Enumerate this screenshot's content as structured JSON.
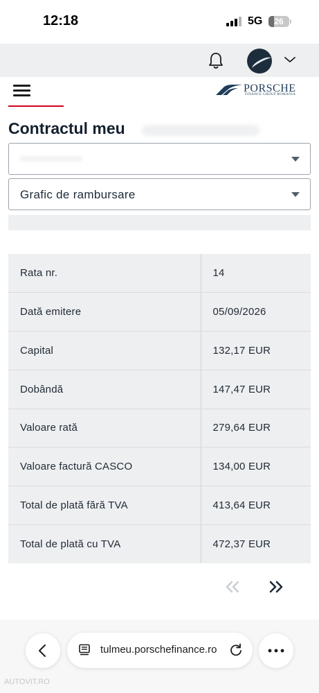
{
  "status_bar": {
    "time": "12:18",
    "network": "5G",
    "battery": "26",
    "battery_level": 0.26
  },
  "header": {
    "logo_text": "PORSCHE",
    "logo_subtext": "FINANCE GROUP ROMANIA"
  },
  "page": {
    "title": "Contractul meu",
    "contract_select_value": "",
    "view_select_value": "Grafic de rambursare"
  },
  "schedule_table": {
    "rows": [
      {
        "label": "Rata nr.",
        "value": "14"
      },
      {
        "label": "Dată emitere",
        "value": "05/09/2026"
      },
      {
        "label": "Capital",
        "value": "132,17 EUR"
      },
      {
        "label": "Dobândă",
        "value": "147,47 EUR"
      },
      {
        "label": "Valoare rată",
        "value": "279,64 EUR"
      },
      {
        "label": "Valoare factură CASCO",
        "value": "134,00 EUR"
      },
      {
        "label": "Total de plată fără TVA",
        "value": "413,64 EUR"
      },
      {
        "label": "Total de plată cu TVA",
        "value": "472,37 EUR"
      }
    ]
  },
  "pagination": {
    "prev_icon": "double-chevron-left-icon",
    "next_icon": "double-chevron-right-icon"
  },
  "browser": {
    "url": "tulmeu.porschefinance.ro"
  },
  "watermark": "AUTOVIT.RO",
  "colors": {
    "accent_red": "#d5001c",
    "brand_navy": "#1f3c5a",
    "table_bg": "#eeeff1"
  }
}
